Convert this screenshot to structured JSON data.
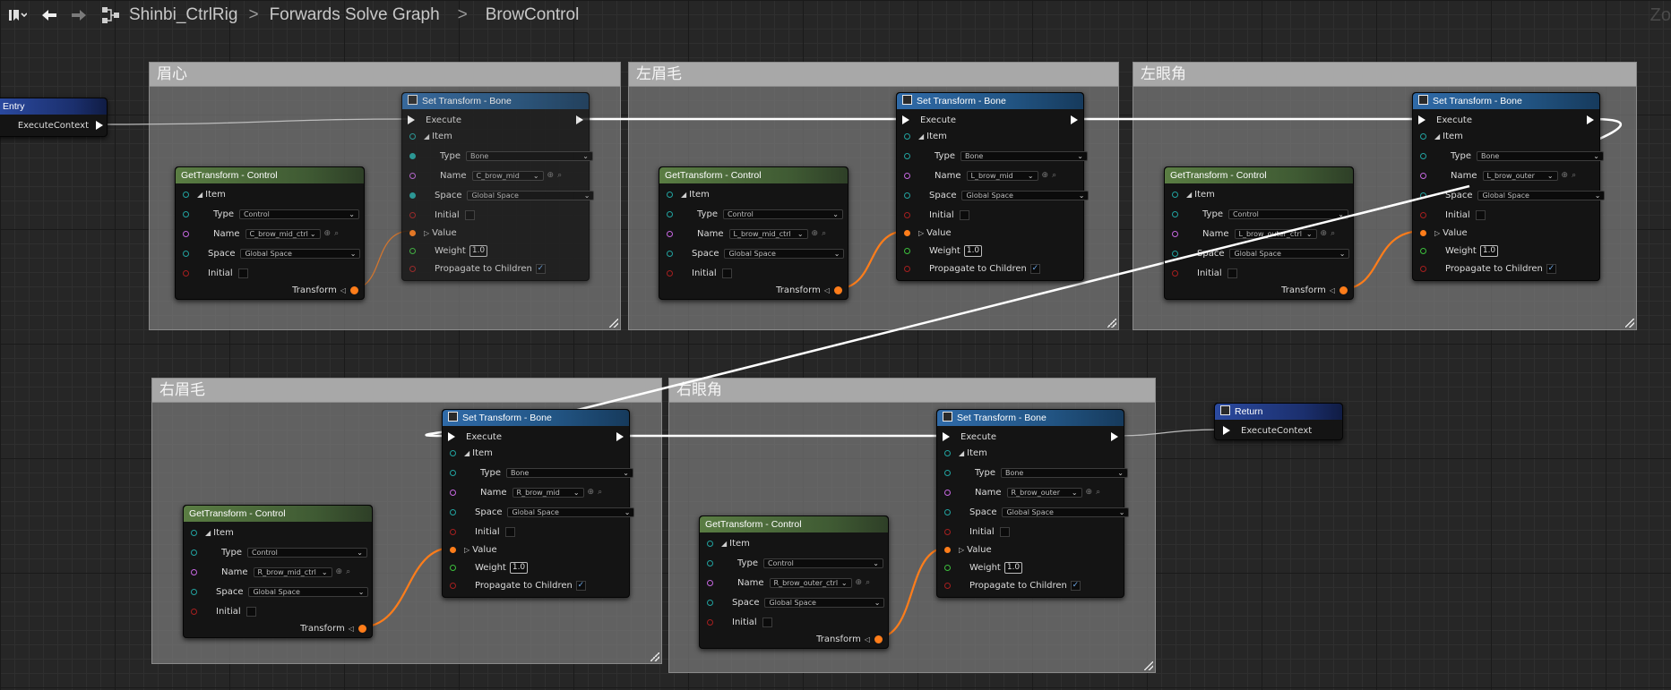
{
  "breadcrumb": [
    "Shinbi_CtrlRig",
    "Forwards Solve Graph",
    "BrowControl"
  ],
  "zoom_label": "Zo",
  "icons": {
    "bookmark": "bookmark-icon",
    "back": "arrow-left-icon",
    "forward": "arrow-right-icon",
    "graph": "graph-icon"
  },
  "comments": [
    "眉心",
    "左眉毛",
    "左眼角",
    "右眉毛",
    "右眼角"
  ],
  "entry": {
    "title": "Entry",
    "pin": "ExecuteContext"
  },
  "return": {
    "title": "Return",
    "pin": "ExecuteContext"
  },
  "labels": {
    "get_title": "GetTransform - Control",
    "set_title": "Set Transform - Bone",
    "execute": "Execute",
    "item": "Item",
    "type": "Type",
    "name": "Name",
    "space": "Space",
    "initial": "Initial",
    "transform": "Transform",
    "value": "Value",
    "weight": "Weight",
    "propagate": "Propagate to Children",
    "control": "Control",
    "bone": "Bone",
    "global_space": "Global Space",
    "weight_value": "1.0"
  },
  "get_names": [
    "C_brow_mid_ctrl",
    "L_brow_mid_ctrl",
    "L_brow_outer_ctrl",
    "R_brow_mid_ctrl",
    "R_brow_outer_ctrl"
  ],
  "set_names": [
    "C_brow_mid",
    "L_brow_mid",
    "L_brow_outer",
    "R_brow_mid",
    "R_brow_outer"
  ]
}
